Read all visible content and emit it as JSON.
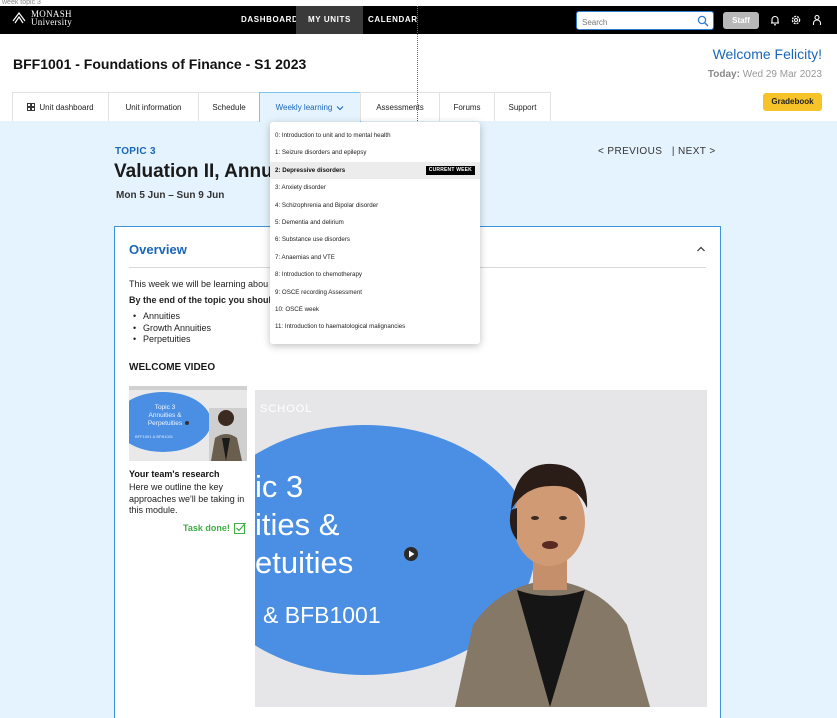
{
  "page_label": "week topic 3",
  "nav": {
    "logo_line1": "MONASH",
    "logo_line2": "University",
    "links": [
      {
        "label": "DASHBOARD"
      },
      {
        "label": "MY UNITS"
      },
      {
        "label": "CALENDAR"
      }
    ],
    "search_placeholder": "Search",
    "staff_label": "Staff"
  },
  "header": {
    "unit_title": "BFF1001 - Foundations of Finance - S1 2023",
    "welcome": "Welcome Felicity!",
    "today_label": "Today:",
    "today_date": "Wed 29 Mar 2023",
    "gradebook_label": "Gradebook",
    "tabs": [
      {
        "label": "Unit dashboard"
      },
      {
        "label": "Unit information"
      },
      {
        "label": "Schedule"
      },
      {
        "label": "Weekly learning"
      },
      {
        "label": "Assessments"
      },
      {
        "label": "Forums"
      },
      {
        "label": "Support"
      }
    ]
  },
  "topic": {
    "label": "TOPIC 3",
    "title": "Valuation II, Annuit",
    "dates": "Mon 5 Jun – Sun 9 Jun",
    "previous": "< PREVIOUS",
    "separator": "|",
    "next": "NEXT >"
  },
  "overview": {
    "title": "Overview",
    "intro": "This week we will be learning abou",
    "by_end": "By the end of the topic you should",
    "points": [
      "Annuities",
      "Growth Annuities",
      "Perpetuities"
    ],
    "welcome_video": "WELCOME VIDEO",
    "thumb_text": [
      "Topic 3",
      "Annuities &",
      "Perpetuities",
      "BFF1001 & BFB1001"
    ],
    "card_title": "Your team's research",
    "card_desc": "Here we outline the key approaches we'll be taking in this module.",
    "task_done": "Task done!",
    "video_text": {
      "school": "SCHOOL",
      "line1": "ic 3",
      "line2": "ities &",
      "line3": "etuities",
      "line4": "& BFB1001"
    }
  },
  "dropdown": {
    "current_badge": "CURRENT WEEK",
    "current_index": 2,
    "items": [
      "0: Introduction to unit and to mental health",
      "1: Seizure disorders and epilepsy",
      "2: Depressive disorders",
      "3: Anxiety disorder",
      "4: Schizophrenia and Bipolar disorder",
      "5: Dementia and delirium",
      "6: Substance use disorders",
      "7: Anaemias and VTE",
      "8: Introduction to chemotherapy",
      "9: OSCE recording Assessment",
      "10: OSCE week",
      "11: Introduction to haematological malignancies"
    ]
  },
  "colors": {
    "brand_blue": "#1b66b8",
    "accent_yellow": "#f6c428",
    "page_bg": "#e4f3fd",
    "success": "#3fae44"
  }
}
